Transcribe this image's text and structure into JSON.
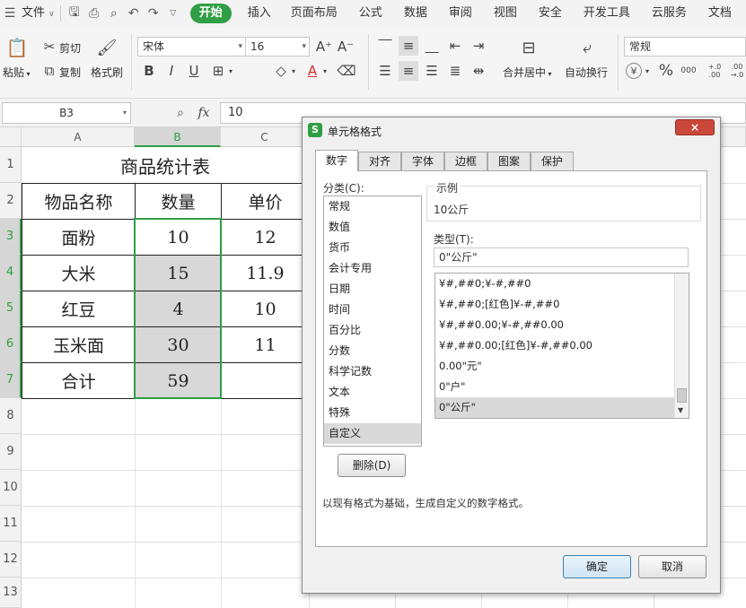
{
  "menubar": {
    "file": "文件",
    "tabs": [
      "开始",
      "插入",
      "页面布局",
      "公式",
      "数据",
      "审阅",
      "视图",
      "安全",
      "开发工具",
      "云服务",
      "文档"
    ]
  },
  "toolbar": {
    "paste": "粘贴",
    "cut": "剪切",
    "copy": "复制",
    "format_painter": "格式刷",
    "font_name": "宋体",
    "font_size": "16",
    "merge_center": "合并居中",
    "wrap_text": "自动换行",
    "number_format": "常规",
    "currency_symbol": "¥",
    "percent_symbol": "%",
    "thousands": "000",
    "inc_decimal": "+.0 .00",
    "dec_decimal": ".00 →.0"
  },
  "formula_bar": {
    "name_box": "B3",
    "fx": "fx",
    "value": "10"
  },
  "sheet": {
    "columns": [
      "A",
      "B",
      "C"
    ],
    "rows": [
      "1",
      "2",
      "3",
      "4",
      "5",
      "6",
      "7",
      "8",
      "9",
      "10",
      "11",
      "12",
      "13"
    ],
    "title": "商品统计表",
    "headers": [
      "物品名称",
      "数量",
      "单价"
    ],
    "data": [
      [
        "面粉",
        "10",
        "12"
      ],
      [
        "大米",
        "15",
        "11.9"
      ],
      [
        "红豆",
        "4",
        "10"
      ],
      [
        "玉米面",
        "30",
        "11"
      ],
      [
        "合计",
        "59",
        ""
      ]
    ]
  },
  "dialog": {
    "title": "单元格格式",
    "close": "×",
    "tabs": [
      "数字",
      "对齐",
      "字体",
      "边框",
      "图案",
      "保护"
    ],
    "category_label": "分类(C):",
    "categories": [
      "常规",
      "数值",
      "货币",
      "会计专用",
      "日期",
      "时间",
      "百分比",
      "分数",
      "科学记数",
      "文本",
      "特殊",
      "自定义"
    ],
    "selected_category": "自定义",
    "sample_label": "示例",
    "sample_value": "10公斤",
    "type_label": "类型(T):",
    "type_value": "0\"公斤\"",
    "type_list": [
      "¥#,##0;¥-#,##0",
      "¥#,##0;[红色]¥-#,##0",
      "¥#,##0.00;¥-#,##0.00",
      "¥#,##0.00;[红色]¥-#,##0.00",
      "0.00\"元\"",
      "0\"户\"",
      "0\"公斤\""
    ],
    "delete_button": "删除(D)",
    "description": "以现有格式为基础，生成自定义的数字格式。",
    "ok_button": "确定",
    "cancel_button": "取消"
  }
}
